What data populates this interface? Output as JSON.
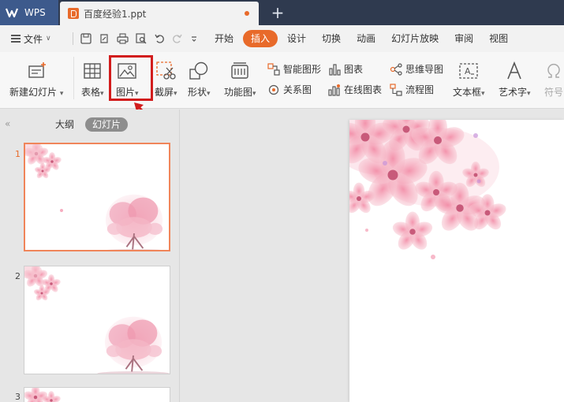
{
  "app": {
    "name": "WPS",
    "document_tab": "百度经验1.ppt"
  },
  "menu": {
    "file_label": "文件",
    "tabs": [
      "开始",
      "插入",
      "设计",
      "切换",
      "动画",
      "幻灯片放映",
      "审阅",
      "视图"
    ],
    "active_tab": "插入"
  },
  "ribbon": {
    "new_slide": "新建幻灯片",
    "table": "表格",
    "picture": "图片",
    "screenshot": "截屏",
    "shape": "形状",
    "function_chart": "功能图",
    "smartart": "智能图形",
    "chart": "图表",
    "relation": "关系图",
    "online_chart": "在线图表",
    "mindmap": "思维导图",
    "flowchart": "流程图",
    "textbox": "文本框",
    "wordart": "艺术字",
    "symbol": "符号"
  },
  "left_panel": {
    "tab_outline": "大纲",
    "tab_slides": "幻灯片",
    "slide_numbers": [
      "1",
      "2",
      "3"
    ],
    "selected_slide": "1"
  },
  "colors": {
    "accent": "#e86a2a",
    "titlebar": "#2f3a4f",
    "wps_tab": "#3d5a8c",
    "highlight_box": "#d21d1d",
    "arrow": "#d21d1d"
  }
}
